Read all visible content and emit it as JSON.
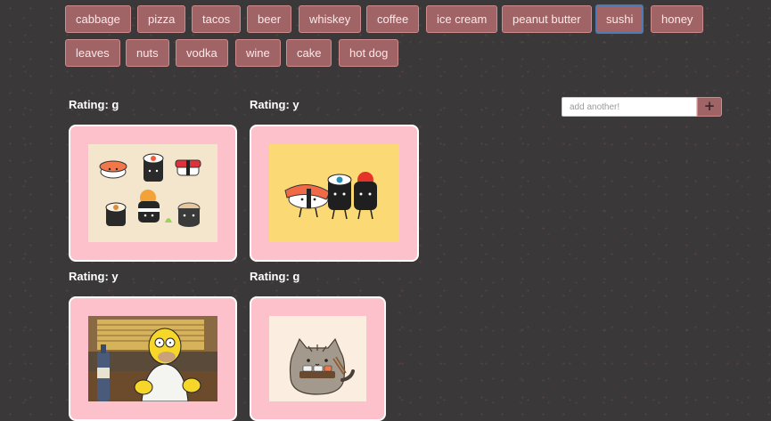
{
  "tags": [
    {
      "label": "cabbage"
    },
    {
      "label": "pizza"
    },
    {
      "label": "tacos"
    },
    {
      "label": "beer"
    },
    {
      "label": "whiskey"
    },
    {
      "label": "coffee"
    },
    {
      "label": "ice cream"
    },
    {
      "label": "peanut butter"
    },
    {
      "label": "sushi",
      "active": true
    },
    {
      "label": "honey"
    },
    {
      "label": "leaves"
    },
    {
      "label": "nuts"
    },
    {
      "label": "vodka"
    },
    {
      "label": "wine"
    },
    {
      "label": "cake"
    },
    {
      "label": "hot dog"
    }
  ],
  "add_tag": {
    "placeholder": "add another!",
    "button_label": "+"
  },
  "results": [
    {
      "rating_label": "Rating:",
      "rating": "g",
      "image": "sushi-characters-grid"
    },
    {
      "rating_label": "Rating:",
      "rating": "y",
      "image": "sushi-trio-walking"
    },
    {
      "rating_label": "Rating:",
      "rating": "y",
      "image": "homer-simpson-bar"
    },
    {
      "rating_label": "Rating:",
      "rating": "g",
      "image": "pusheen-cat-sushi"
    }
  ],
  "colors": {
    "background": "#3a3839",
    "tag_fill": "#a16466",
    "tag_active_border": "#4e79b3",
    "card_fill": "#fdc1cb"
  }
}
